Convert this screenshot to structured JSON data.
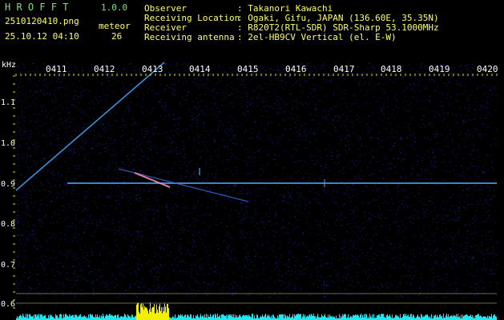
{
  "header": {
    "app_title": "H R O F F T",
    "version": "1.0.0",
    "filename": "2510120410.png",
    "counter_label": "meteor",
    "timestamp": "25.10.12 04:10",
    "counter_value": "26",
    "info": [
      {
        "label": "Observer",
        "value": ": Takanori Kawachi"
      },
      {
        "label": "Receiving Location",
        "value": ": Ogaki, Gifu, JAPAN (136.60E, 35.35N)"
      },
      {
        "label": "Receiver",
        "value": ": R820T2(RTL-SDR) SDR-Sharp 53.1000MHz"
      },
      {
        "label": "Receiving antenna",
        "value": ": 2el-HB9CV Vertical (el. E-W)"
      }
    ]
  },
  "axis": {
    "unit": "kHz",
    "time_labels": [
      "0411",
      "0412",
      "0413",
      "0414",
      "0415",
      "0416",
      "0417",
      "0418",
      "0419",
      "0420"
    ],
    "freq_labels": [
      "1.1",
      "1.0",
      "0.9",
      "0.8",
      "0.7",
      "0.6"
    ]
  },
  "colors": {
    "background": "#000000",
    "title_green": "#7ee07e",
    "label_yellow": "#ffff66",
    "text_white": "#ffffff",
    "tick_yellow": "#e0e000",
    "noise_blue": "#1a2a9a",
    "carrier": "#4aa8ff",
    "activity_cyan": "#20e8f0",
    "activity_yellow": "#f0f000"
  }
}
